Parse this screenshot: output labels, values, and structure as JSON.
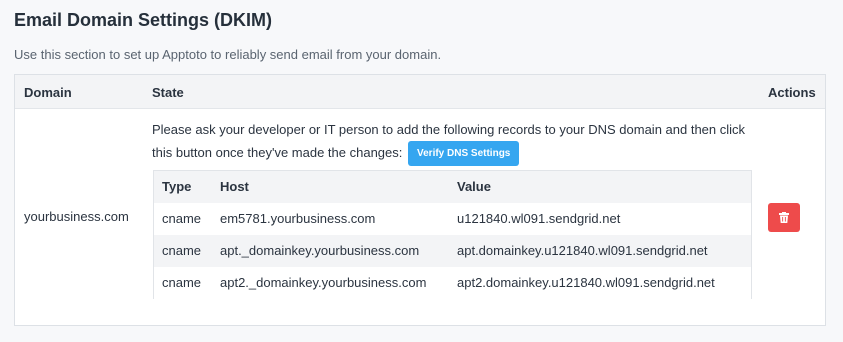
{
  "header": {
    "title": "Email Domain Settings (DKIM)",
    "subtitle": "Use this section to set up Apptoto to reliably send email from your domain."
  },
  "table": {
    "columns": {
      "domain": "Domain",
      "state": "State",
      "actions": "Actions"
    },
    "domain": "yourbusiness.com",
    "message": "Please ask your developer or IT person to add the following records to your DNS domain and then click this button once they've made the changes:",
    "verify_label": "Verify DNS Settings",
    "delete_icon": "trash-icon",
    "delete_color": "#ee4b4b",
    "verify_color": "#35a6f0"
  },
  "records": {
    "columns": {
      "type": "Type",
      "host": "Host",
      "value": "Value"
    },
    "rows": [
      {
        "type": "cname",
        "host": "em5781.yourbusiness.com",
        "value": "u121840.wl091.sendgrid.net"
      },
      {
        "type": "cname",
        "host": "apt._domainkey.yourbusiness.com",
        "value": "apt.domainkey.u121840.wl091.sendgrid.net"
      },
      {
        "type": "cname",
        "host": "apt2._domainkey.yourbusiness.com",
        "value": "apt2.domainkey.u121840.wl091.sendgrid.net"
      }
    ]
  }
}
